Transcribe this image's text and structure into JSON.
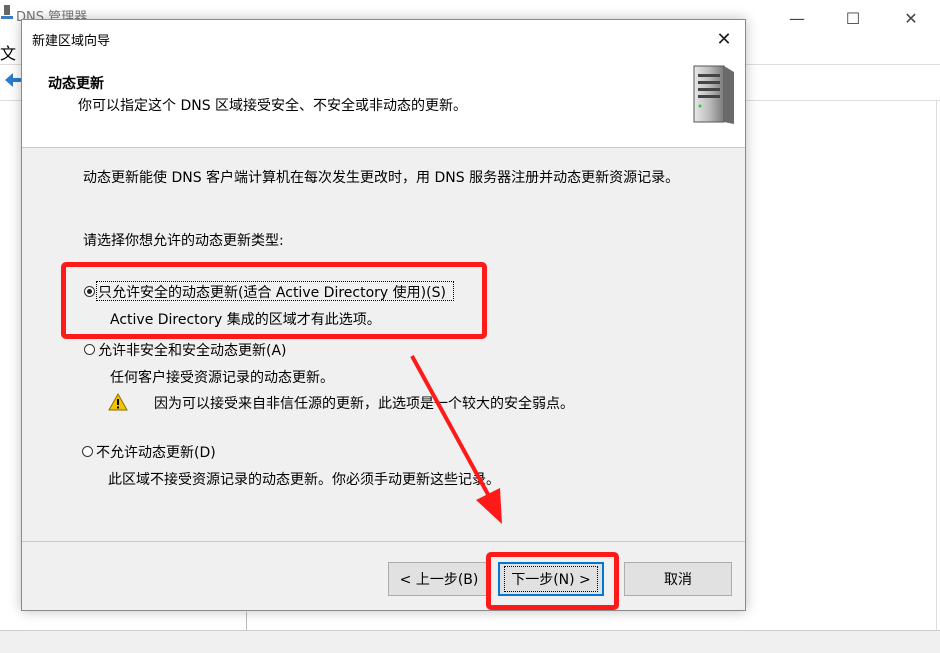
{
  "background_window": {
    "title": "DNS 管理器",
    "menu_first": "文",
    "controls": {
      "minimize": "—",
      "maximize": "☐",
      "close": "✕"
    }
  },
  "dialog": {
    "title": "新建区域向导",
    "close": "✕",
    "header": {
      "title": "动态更新",
      "subtitle": "你可以指定这个 DNS 区域接受安全、不安全或非动态的更新。",
      "icon": "server-icon"
    },
    "description": "动态更新能使 DNS 客户端计算机在每次发生更改时，用 DNS 服务器注册并动态更新资源记录。",
    "prompt": "请选择你想允许的动态更新类型:",
    "options": [
      {
        "label": "只允许安全的动态更新(适合 Active Directory 使用)(S)",
        "description": "Active Directory 集成的区域才有此选项。",
        "selected": true
      },
      {
        "label": "允许非安全和安全动态更新(A)",
        "description": "任何客户接受资源记录的动态更新。",
        "warning": "因为可以接受来自非信任源的更新，此选项是一个较大的安全弱点。",
        "selected": false
      },
      {
        "label": "不允许动态更新(D)",
        "description": "此区域不接受资源记录的动态更新。你必须手动更新这些记录。",
        "selected": false
      }
    ],
    "buttons": {
      "back": "< 上一步(B)",
      "next": "下一步(N) >",
      "cancel": "取消"
    }
  },
  "annotation_color": "#ff1a1a"
}
